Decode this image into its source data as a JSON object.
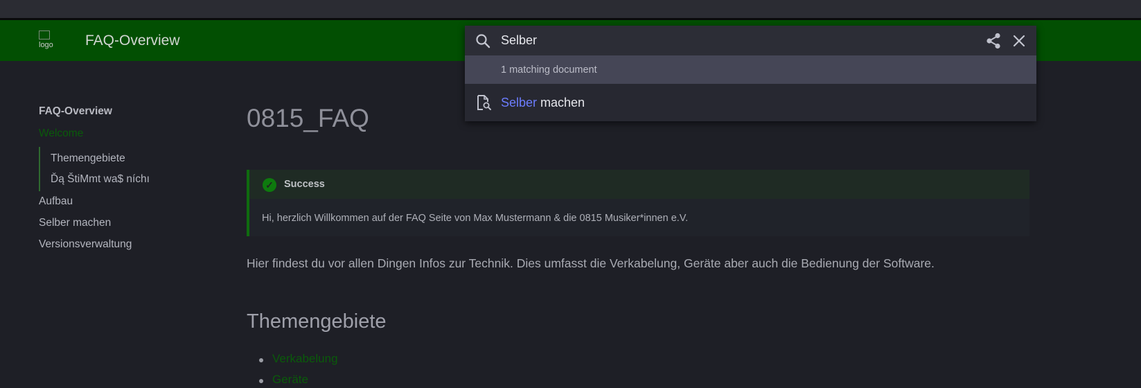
{
  "header": {
    "logo_alt": "logo",
    "site_title": "FAQ-Overview"
  },
  "sidebar": {
    "heading": "FAQ-Overview",
    "welcome": "Welcome",
    "sub_items": [
      "Themengebiete",
      "Ďą ŠtiMmt wa$ níchı"
    ],
    "items": [
      "Aufbau",
      "Selber machen",
      "Versionsverwaltung"
    ]
  },
  "main": {
    "title": "0815_FAQ",
    "admonition": {
      "title": "Success",
      "body": "Hi, herzlich Willkommen auf der FAQ Seite von Max Mustermann & die 0815 Musiker*innen e.V."
    },
    "paragraph": "Hier findest du vor allen Dingen Infos zur Technik. Dies umfasst die Verkabelung, Geräte aber auch die Bedienung der Software.",
    "section_title": "Themengebiete",
    "bullets": [
      "Verkabelung",
      "Geräte"
    ]
  },
  "search": {
    "query": "Selber",
    "match_count": "1 matching document",
    "result_highlight": "Selber",
    "result_rest": " machen",
    "icons": [
      "search-icon",
      "share-icon",
      "close-icon",
      "document-search-icon"
    ],
    "highlight_color": "#6c7dff"
  },
  "colors": {
    "header_bg": "#024f02",
    "accent_green": "#0a5a0a",
    "page_bg": "#1e1f26"
  }
}
